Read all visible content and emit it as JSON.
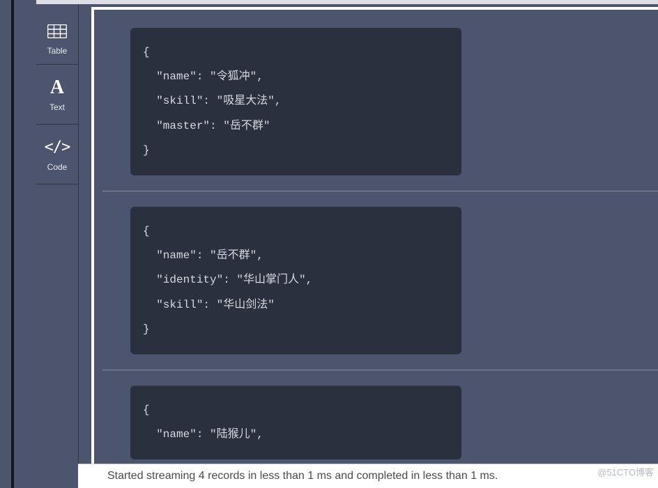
{
  "sidebar": {
    "items": [
      {
        "label": "Table"
      },
      {
        "label": "Text"
      },
      {
        "label": "Code"
      }
    ]
  },
  "records": [
    {
      "lines": [
        "{",
        "  \"name\": \"令狐冲\",",
        "  \"skill\": \"吸星大法\",",
        "  \"master\": \"岳不群\"",
        "}"
      ]
    },
    {
      "lines": [
        "{",
        "  \"name\": \"岳不群\",",
        "  \"identity\": \"华山掌门人\",",
        "  \"skill\": \"华山剑法\"",
        "}"
      ]
    },
    {
      "lines": [
        "{",
        "  \"name\": \"陆猴儿\","
      ]
    }
  ],
  "status": {
    "message": "Started streaming 4 records in less than 1 ms and completed in less than 1 ms."
  },
  "watermark": "@51CTO博客"
}
